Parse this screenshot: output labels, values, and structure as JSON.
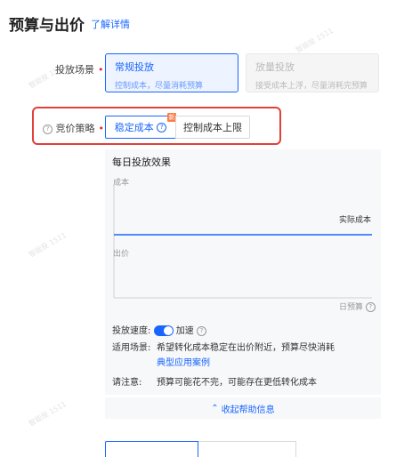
{
  "header": {
    "title": "预算与出价",
    "detail_link": "了解详情"
  },
  "placement": {
    "label": "投放场景",
    "options": [
      {
        "title": "常规投放",
        "subtitle": "控制成本，尽量消耗预算",
        "selected": true
      },
      {
        "title": "放量投放",
        "subtitle": "接受成本上浮，尽量消耗完预算",
        "selected": false,
        "disabled": true
      }
    ]
  },
  "bidding": {
    "label": "竞价策略",
    "options": [
      {
        "label": "稳定成本",
        "badge": "新",
        "selected": true
      },
      {
        "label": "控制成本上限",
        "selected": false
      }
    ]
  },
  "help_panel": {
    "chart_title": "每日投放效果",
    "y_label": "成本",
    "x_label": "日预算",
    "line_actual": "实际成本",
    "line_bid": "出价",
    "speed_label": "投放速度:",
    "speed_value": "加速",
    "scenario_label": "适用场景:",
    "scenario_text": "希望转化成本稳定在出价附近，预算尽快消耗",
    "case_link": "典型应用案例",
    "note_label": "请注意:",
    "note_text": "预算可能花不完，可能存在更低转化成本",
    "collapse_link": "收起帮助信息"
  },
  "watermark": "智能投 1511",
  "colors": {
    "primary": "#1966ff",
    "required": "#f5222d",
    "highlight": "#e0413a"
  }
}
